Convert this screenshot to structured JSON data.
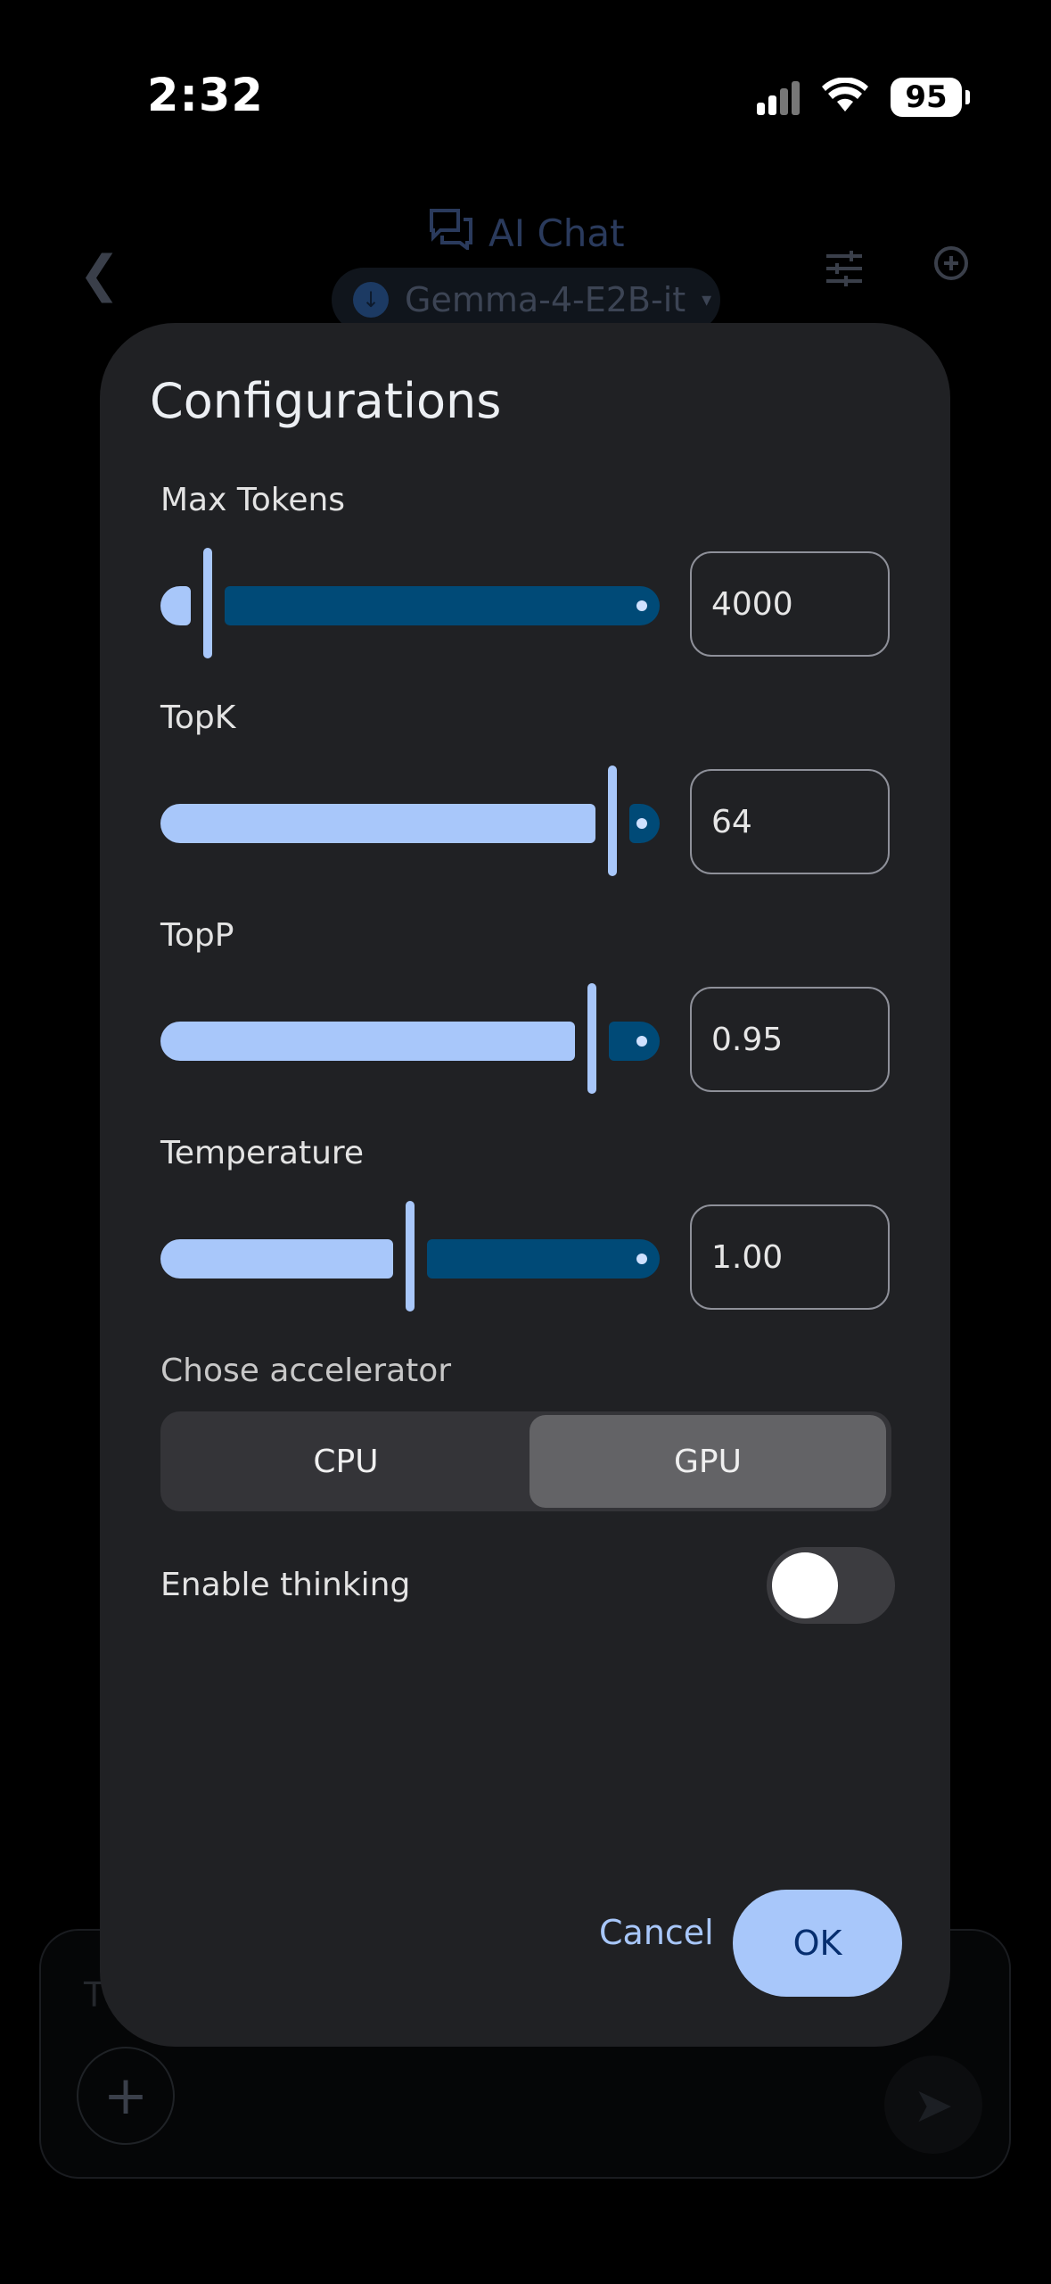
{
  "status_bar": {
    "time": "2:32",
    "battery": "95",
    "icons": [
      "cellular-signal-icon",
      "wifi-icon",
      "battery-icon"
    ]
  },
  "background": {
    "title": "AI Chat",
    "model": "Gemma-4-E2B-it",
    "input_placeholder": "T",
    "icons": [
      "back-arrow-icon",
      "chat-bubbles-icon",
      "download-icon",
      "dropdown-arrow-icon",
      "tune-icon",
      "new-chat-icon",
      "plus-icon",
      "send-icon"
    ]
  },
  "dialog": {
    "title": "Configurations",
    "params": [
      {
        "label": "Max Tokens",
        "value": "4000",
        "fraction": 0.0
      },
      {
        "label": "TopK",
        "value": "64",
        "fraction": 1.0
      },
      {
        "label": "TopP",
        "value": "0.95",
        "fraction": 0.95
      },
      {
        "label": "Temperature",
        "value": "1.00",
        "fraction": 0.5
      }
    ],
    "accelerator": {
      "label": "Chose accelerator",
      "options": [
        "CPU",
        "GPU"
      ],
      "selected": "GPU"
    },
    "thinking": {
      "label": "Enable thinking",
      "enabled": false
    },
    "cancel_label": "Cancel",
    "ok_label": "OK"
  },
  "colors": {
    "slider_active": "#a8c7fa",
    "slider_inactive": "#004a77",
    "dialog_bg": "#202124",
    "ok_button": "#a8c7fa"
  }
}
